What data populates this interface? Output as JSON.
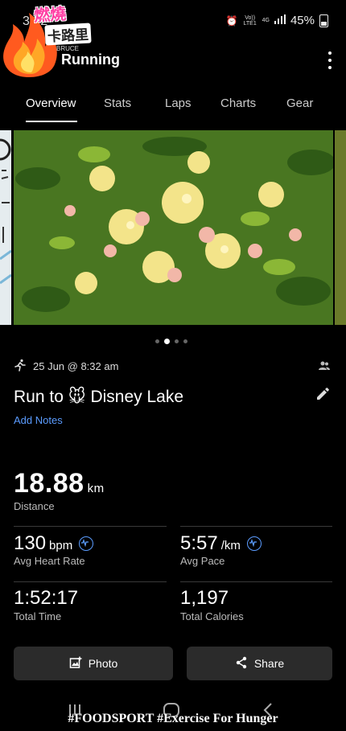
{
  "status_bar": {
    "time": "3:52",
    "volte": "Vo)) LTE1",
    "network": "4G",
    "battery": "45%"
  },
  "logo": {
    "text_top": "燃燒",
    "text_bottom": "卡路里",
    "sub": "BRUCE"
  },
  "header": {
    "title": "Running"
  },
  "tabs": [
    {
      "label": "Overview",
      "active": true
    },
    {
      "label": "Stats"
    },
    {
      "label": "Laps"
    },
    {
      "label": "Charts"
    },
    {
      "label": "Gear"
    }
  ],
  "carousel": {
    "pages": 4,
    "active_index": 1
  },
  "activity": {
    "datetime": "25 Jun @ 8:32 am",
    "title_before": "Run to",
    "title_emoji": "🐭",
    "title_after": "Disney Lake",
    "add_notes": "Add Notes"
  },
  "stats": {
    "distance": {
      "value": "18.88",
      "unit": "km",
      "label": "Distance"
    },
    "heart_rate": {
      "value": "130",
      "unit": "bpm",
      "label": "Avg Heart Rate"
    },
    "pace": {
      "value": "5:57",
      "unit": "/km",
      "label": "Avg Pace"
    },
    "time": {
      "value": "1:52:17",
      "label": "Total Time"
    },
    "calories": {
      "value": "1,197",
      "label": "Total Calories"
    }
  },
  "buttons": {
    "photo": "Photo",
    "share": "Share"
  },
  "watermark": "#FOODSPORT #Exercise For Hunger",
  "colors": {
    "accent": "#5b9cff",
    "button_bg": "#2b2b2b"
  }
}
